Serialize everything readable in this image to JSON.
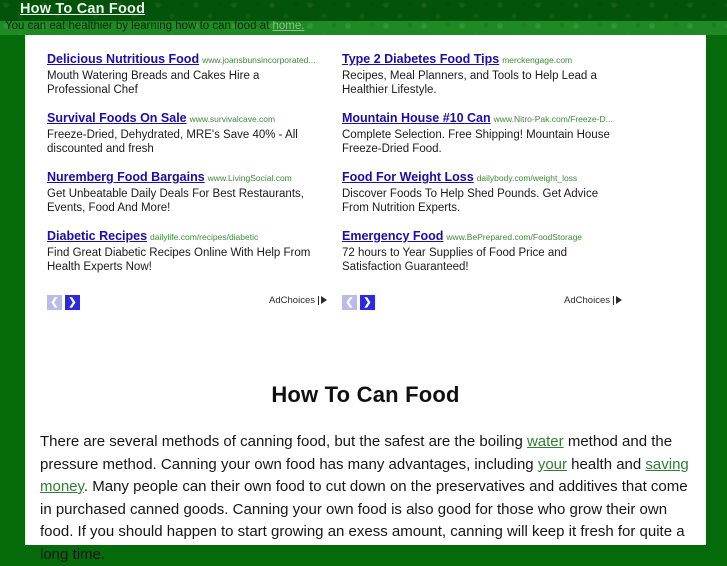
{
  "header": {
    "site_title": "How To Can Food",
    "tagline_prefix": "You can eat healthier by learning how to can food at ",
    "tagline_link": "home."
  },
  "ads": {
    "left_column": [
      {
        "title": "Delicious Nutritious Food",
        "url": "www.joansbunsincorporated...",
        "description": "Mouth Watering Breads and Cakes Hire a Professional Chef"
      },
      {
        "title": "Survival Foods On Sale",
        "url": "www.survivalcave.com",
        "description": "Freeze-Dried, Dehydrated, MRE's Save 40% - All discounted and fresh"
      },
      {
        "title": "Nuremberg Food Bargains",
        "url": "www.LivingSocial.com",
        "description": "Get Unbeatable Daily Deals For Best Restaurants, Events, Food And More!"
      },
      {
        "title": "Diabetic Recipes",
        "url": "dailylife.com/recipes/diabetic",
        "description": "Find Great Diabetic Recipes Online With Help From Health Experts Now!"
      }
    ],
    "right_column": [
      {
        "title": "Type 2 Diabetes Food Tips",
        "url": "merckengage.com",
        "description": "Recipes, Meal Planners, and Tools to Help Lead a Healthier Lifestyle."
      },
      {
        "title": "Mountain House #10 Can",
        "url": "www.Nitro-Pak.com/Freeze-D...",
        "description": "Complete Selection. Free Shipping! Mountain House Freeze-Dried Food."
      },
      {
        "title": "Food For Weight Loss",
        "url": "dailybody.com/weight_loss",
        "description": "Discover Foods To Help Shed Pounds. Get Advice From Nutrition Experts."
      },
      {
        "title": "Emergency Food",
        "url": "www.BePrepared.com/FoodStorage",
        "description": "72 hours to Year Supplies of Food Price and Satisfaction Guaranteed!"
      }
    ],
    "controls": {
      "prev_label": "❮",
      "next_label": "❯",
      "adchoices_label": "AdChoices"
    }
  },
  "article": {
    "heading": "How To Can Food",
    "paragraph": {
      "part1": "There are several methods of canning food, but the safest are the boiling ",
      "link1": "water",
      "part2": " method and the pressure method.  Canning your own food has many advantages, including ",
      "link2": "your",
      "part3": " health and ",
      "link3": "saving money",
      "part4": ".  Many people can their own food to cut down on the preservatives and additives that come in purchased canned goods.  Canning your own food is also good for those who grow their own food.  If you should happen to start growing an exess amount, canning will keep it fresh for quite a long time."
    }
  },
  "colors": {
    "page_green": "#046a0a",
    "banner_green": "#04530a",
    "tagline_green": "#1f8a23",
    "ad_title_blue": "#1a0dab",
    "ad_url_green": "#3d8b37",
    "inline_link_green": "#2f7d32",
    "next_arrow_blue": "#2b2bdd",
    "prev_arrow_grey": "#b9bbe8"
  }
}
